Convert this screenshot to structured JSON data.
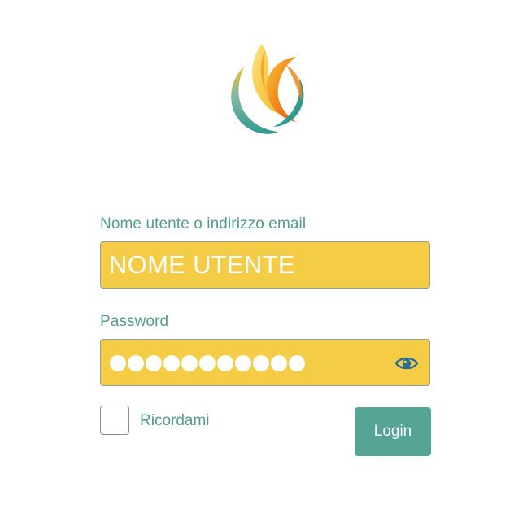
{
  "form": {
    "username_label": "Nome utente o indirizzo email",
    "username_value": "NOME UTENTE",
    "password_label": "Password",
    "password_masked_length": 11,
    "remember_label": "Ricordami",
    "remember_checked": false,
    "login_label": "Login"
  },
  "icons": {
    "logo": "logo-icon",
    "show_password": "eye-icon"
  },
  "colors": {
    "accent": "#4f9c8f",
    "field_bg": "#f5cc45",
    "button_bg": "#56a594"
  }
}
